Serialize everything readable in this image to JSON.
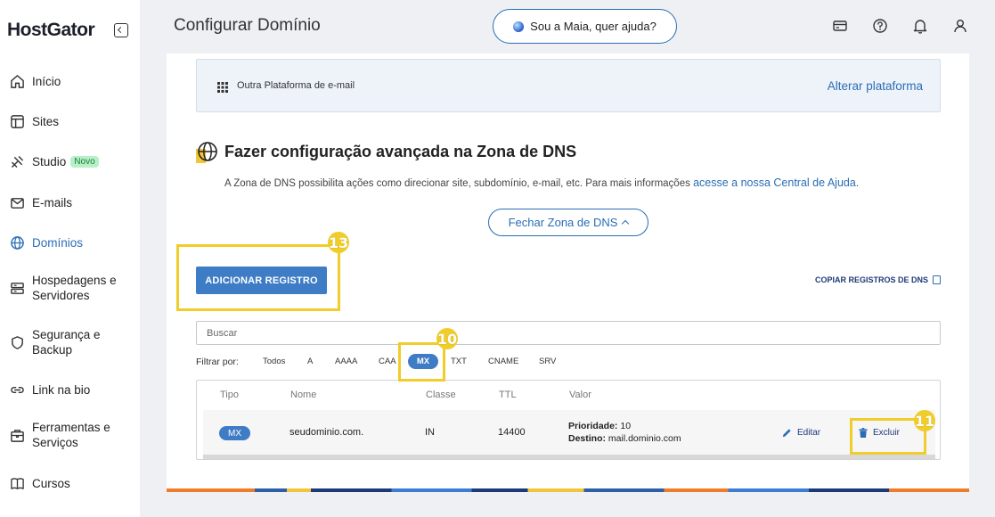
{
  "sidebar": {
    "logo": "HostGator",
    "items": [
      {
        "label": "Início",
        "icon": "home-icon"
      },
      {
        "label": "Sites",
        "icon": "browser-icon"
      },
      {
        "label": "Studio",
        "icon": "studio-icon",
        "badge": "Novo"
      },
      {
        "label": "E-mails",
        "icon": "mail-icon"
      },
      {
        "label": "Domínios",
        "icon": "globe-icon",
        "active": true
      },
      {
        "label": "Hospedagens e Servidores",
        "icon": "server-icon"
      },
      {
        "label": "Segurança e Backup",
        "icon": "shield-icon"
      },
      {
        "label": "Link na bio",
        "icon": "link-icon"
      },
      {
        "label": "Ferramentas e Serviços",
        "icon": "toolbox-icon"
      },
      {
        "label": "Cursos",
        "icon": "book-icon"
      }
    ]
  },
  "header": {
    "title": "Configurar Domínio",
    "assistant_label": "Sou a Maia, quer ajuda?",
    "icons": [
      "card-icon",
      "help-icon",
      "bell-icon",
      "user-icon"
    ]
  },
  "platform": {
    "label": "Outra Plataforma de e-mail",
    "change_link": "Alterar plataforma"
  },
  "dns": {
    "title": "Fazer configuração avançada na Zona de DNS",
    "description": "A Zona de DNS possibilita ações como direcionar site, subdomínio, e-mail, etc. Para mais informações",
    "help_link": "acesse a nossa Central de Ajuda",
    "description_end": ".",
    "close_button": "Fechar Zona de DNS",
    "add_button": "ADICIONAR REGISTRO",
    "copy_link": "COPIAR REGISTROS DE DNS",
    "search_placeholder": "Buscar",
    "filter_label": "Filtrar por:",
    "filters": [
      "Todos",
      "A",
      "AAAA",
      "CAA",
      "MX",
      "TXT",
      "CNAME",
      "SRV"
    ],
    "active_filter": "MX",
    "table": {
      "headers": [
        "Tipo",
        "Nome",
        "Classe",
        "TTL",
        "Valor"
      ],
      "rows": [
        {
          "type": "MX",
          "name": "seudominio.com.",
          "class": "IN",
          "ttl": "14400",
          "priority_label": "Prioridade:",
          "priority": "10",
          "dest_label": "Destino:",
          "dest": "mail.dominio.com",
          "edit": "Editar",
          "delete": "Excluir"
        }
      ]
    }
  },
  "annotations": {
    "marker_add": "13",
    "marker_filter": "10",
    "marker_delete": "11",
    "color": "#f0cd28"
  },
  "colors": {
    "accent": "#2a6db5",
    "button": "#3e7cc6",
    "badge_new": "#b6f0c6"
  }
}
